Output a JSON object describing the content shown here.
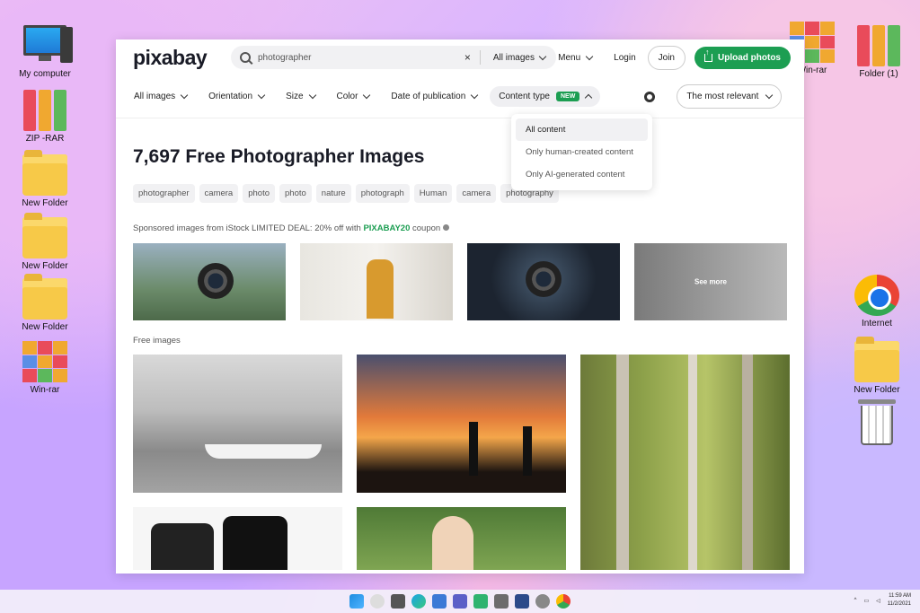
{
  "desktop": {
    "left_icons": [
      {
        "label": "My computer",
        "icon": "computer-icon"
      },
      {
        "label": "ZIP -RAR",
        "icon": "binders-icon"
      },
      {
        "label": "New Folder",
        "icon": "folder-icon"
      },
      {
        "label": "New Folder",
        "icon": "folder-icon"
      },
      {
        "label": "New Folder",
        "icon": "folder-icon"
      },
      {
        "label": "Win-rar",
        "icon": "winrar-icon"
      }
    ],
    "right_icons": [
      {
        "label": "Win-rar",
        "icon": "winrar-icon"
      },
      {
        "label": "Folder (1)",
        "icon": "binders-icon"
      },
      {
        "label": "Internet",
        "icon": "chrome-icon"
      },
      {
        "label": "New Folder",
        "icon": "folder-icon"
      },
      {
        "label": "",
        "icon": "recycle-bin-icon"
      }
    ]
  },
  "header": {
    "logo": "pixabay",
    "search_value": "photographer",
    "clear": "×",
    "scope": "All images",
    "menu": "Menu",
    "login": "Login",
    "join": "Join",
    "upload": "Upload photos"
  },
  "filters": {
    "items": [
      "All images",
      "Orientation",
      "Size",
      "Color",
      "Date of publication"
    ],
    "content_type": "Content type",
    "badge": "NEW",
    "sort": "The most relevant"
  },
  "dropdown": {
    "options": [
      "All content",
      "Only human-created content",
      "Only AI-generated content"
    ],
    "selected_index": 0
  },
  "main": {
    "heading": "7,697 Free Photographer Images",
    "tags": [
      "photographer",
      "camera",
      "photo",
      "photo",
      "nature",
      "photograph",
      "Human",
      "camera",
      "photography"
    ],
    "sponsored_prefix": "Sponsored images from iStock LIMITED DEAL: 20% off with ",
    "sponsored_code": "PIXABAY20",
    "sponsored_suffix": " coupon",
    "see_more": "See more",
    "free_label": "Free images"
  },
  "taskbar": {
    "time": "11:59 AM",
    "date": "11/2/2021"
  },
  "colors": {
    "accent": "#1c9e52",
    "text": "#191b26"
  }
}
